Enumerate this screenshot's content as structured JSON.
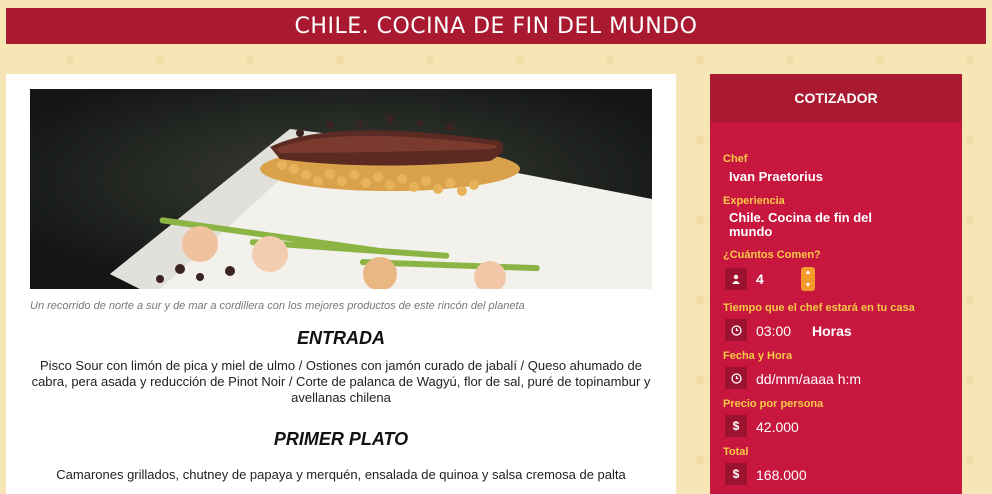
{
  "header": {
    "title": "CHILE. COCINA DE FIN DEL MUNDO"
  },
  "hero": {
    "caption": "Un recorrido de norte a sur y de mar a cordillera con los mejores productos de este rincón del planeta"
  },
  "menu": {
    "sections": [
      {
        "title": "ENTRADA",
        "body": "Pisco Sour con limón de pica y miel de ulmo / Ostiones con jamón curado de jabalí / Queso ahumado de cabra, pera asada y reducción de Pinot Noir / Corte de palanca de Wagyú, flor de sal, puré de topinambur y avellanas chilena"
      },
      {
        "title": "PRIMER PLATO",
        "body": "Camarones grillados, chutney de papaya y merquén, ensalada de quinoa y salsa cremosa de palta"
      }
    ]
  },
  "quoter": {
    "title": "COTIZADOR",
    "chef_label": "Chef",
    "chef_value": "Ivan Praetorius",
    "experience_label": "Experiencia",
    "experience_value": "Chile. Cocina de fin del mundo",
    "guests_label": "¿Cuántos Comen?",
    "guests_value": "4",
    "time_label": "Tiempo que el chef estará en tu casa",
    "time_value": "03:00",
    "time_unit": "Horas",
    "date_label": "Fecha y Hora",
    "date_placeholder": "dd/mm/aaaa h:m",
    "price_label": "Precio por persona",
    "price_currency": "$",
    "price_value": "42.000",
    "total_label": "Total",
    "total_currency": "$",
    "total_value": "168.000"
  },
  "colors": {
    "brand_red": "#a91a31",
    "panel_red": "#c8173f",
    "label_yellow": "#f7c948",
    "stepper_orange": "#f59a2b",
    "page_bg": "#f7e6b5"
  },
  "icons": {
    "guests": "user-icon",
    "time": "clock-icon",
    "date": "clock-icon",
    "price": "dollar-icon",
    "total": "dollar-icon"
  }
}
